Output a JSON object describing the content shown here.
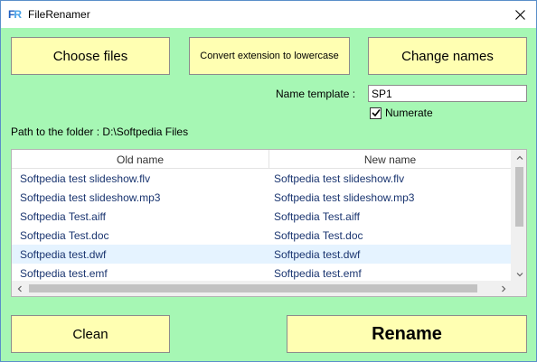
{
  "window": {
    "title": "FileRenamer",
    "icon_text_a": "F",
    "icon_text_b": "R",
    "close_icon": "close-icon"
  },
  "toolbar": {
    "choose_label": "Choose files",
    "convert_label": "Convert extension to lowercase",
    "change_label": "Change names"
  },
  "template": {
    "label": "Name template :",
    "value": "SP1"
  },
  "numerate": {
    "label": "Numerate",
    "checked": true
  },
  "path": {
    "text": "Path to the folder : D:\\Softpedia Files"
  },
  "table": {
    "columns": [
      "Old name",
      "New name"
    ],
    "rows": [
      {
        "old": "Softpedia test slideshow.flv",
        "new": "Softpedia test slideshow.flv"
      },
      {
        "old": "Softpedia test slideshow.mp3",
        "new": "Softpedia test slideshow.mp3"
      },
      {
        "old": "Softpedia Test.aiff",
        "new": "Softpedia Test.aiff"
      },
      {
        "old": "Softpedia Test.doc",
        "new": "Softpedia Test.doc"
      },
      {
        "old": "Softpedia test.dwf",
        "new": "Softpedia test.dwf"
      },
      {
        "old": "Softpedia test.emf",
        "new": "Softpedia test.emf"
      }
    ],
    "selected_row": 4
  },
  "footer": {
    "clean_label": "Clean",
    "rename_label": "Rename"
  },
  "colors": {
    "background": "#a6f7b4",
    "button": "#ffffb2",
    "row_selected": "#e5f3ff",
    "cell_text": "#1a3570"
  }
}
